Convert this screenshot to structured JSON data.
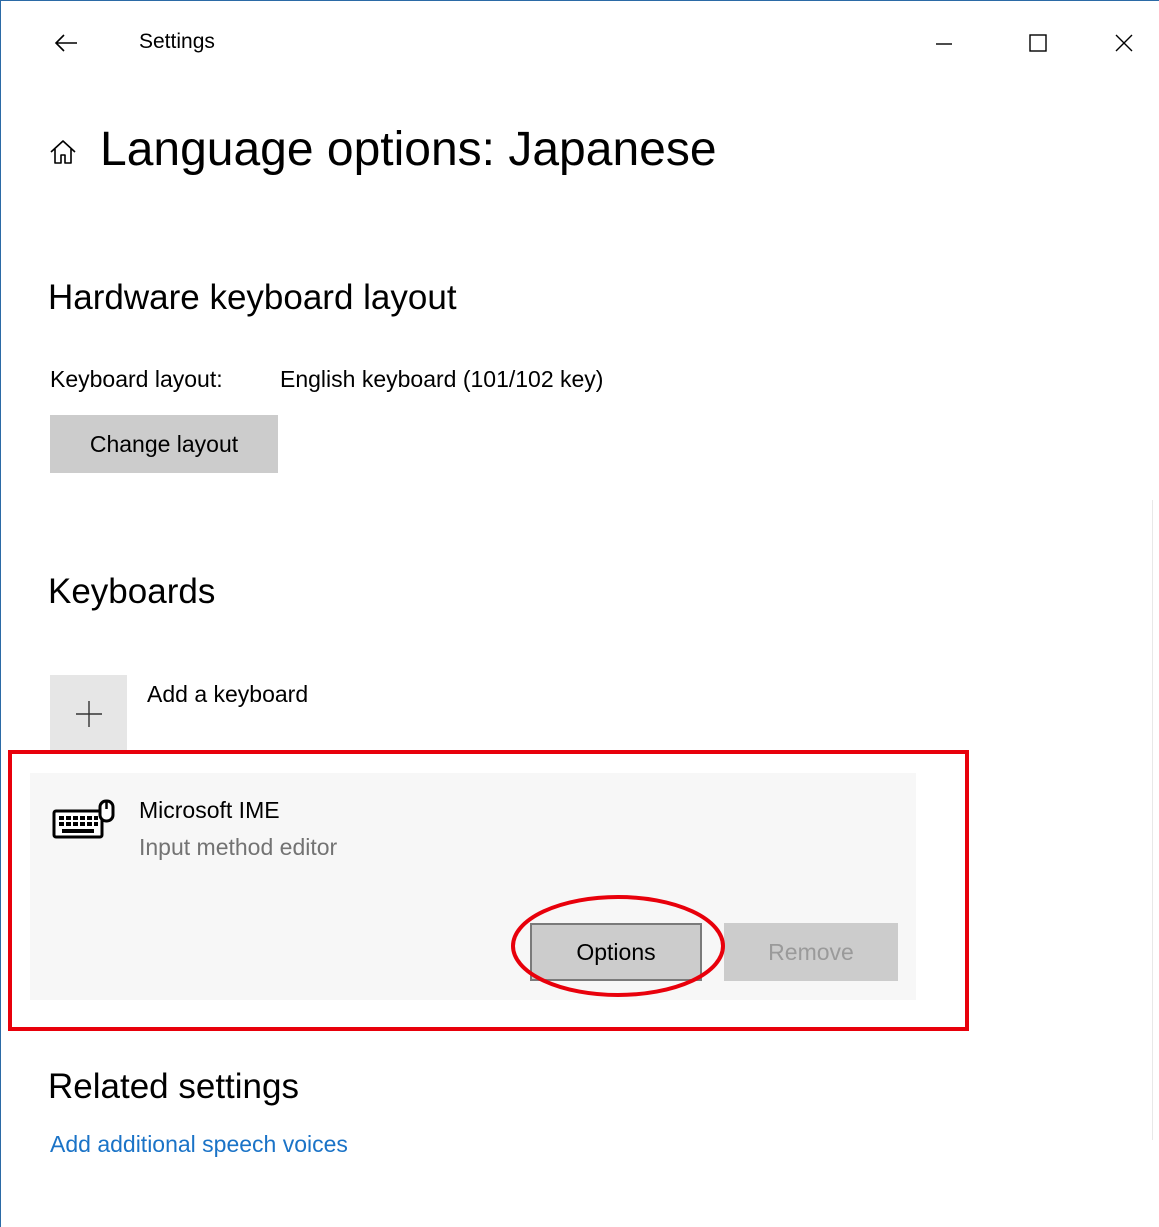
{
  "window": {
    "app_title": "Settings"
  },
  "page": {
    "title": "Language options: Japanese"
  },
  "hardware_keyboard": {
    "section_title": "Hardware keyboard layout",
    "layout_label": "Keyboard layout:",
    "layout_value": "English keyboard (101/102 key)",
    "change_layout_label": "Change layout"
  },
  "keyboards": {
    "section_title": "Keyboards",
    "add_keyboard_label": "Add a keyboard",
    "items": [
      {
        "name": "Microsoft IME",
        "description": "Input method editor",
        "icon": "keyboard-icon",
        "options_label": "Options",
        "remove_label": "Remove",
        "remove_enabled": false
      }
    ]
  },
  "related": {
    "section_title": "Related settings",
    "link_label": "Add additional speech voices"
  },
  "colors": {
    "accent_link": "#1a73c7",
    "annotation_red": "#e8000b",
    "button_bg": "#cccccc"
  }
}
